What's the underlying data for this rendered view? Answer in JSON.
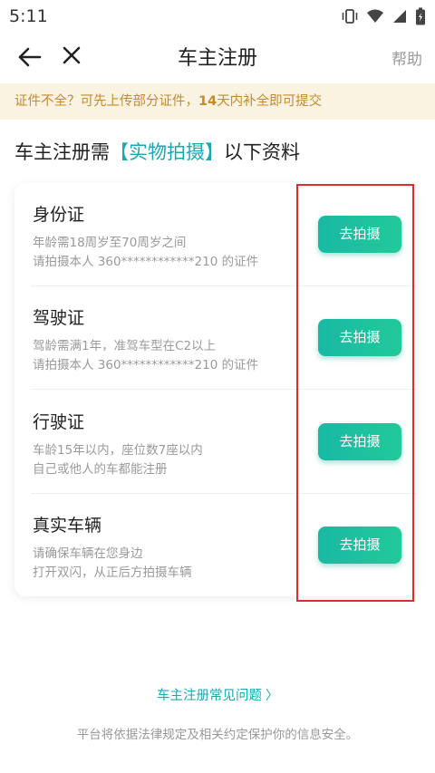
{
  "status_bar": {
    "time": "5:11"
  },
  "nav": {
    "title": "车主注册",
    "help_label": "帮助"
  },
  "notice": {
    "prefix": "证件不全？可先上传部分证件，",
    "emphasis": "14",
    "suffix": "天内补全即可提交"
  },
  "heading": {
    "before": "车主注册需",
    "accent": "【实物拍摄】",
    "after": "以下资料"
  },
  "documents": [
    {
      "title": "身份证",
      "line1": "年龄需18周岁至70周岁之间",
      "line2": "请拍摄本人 360************210 的证件",
      "button": "去拍摄"
    },
    {
      "title": "驾驶证",
      "line1": "驾龄需满1年，准驾车型在C2以上",
      "line2": "请拍摄本人 360************210 的证件",
      "button": "去拍摄"
    },
    {
      "title": "行驶证",
      "line1": "车龄15年以内，座位数7座以内",
      "line2": "自己或他人的车都能注册",
      "button": "去拍摄"
    },
    {
      "title": "真实车辆",
      "line1": "请确保车辆在您身边",
      "line2": "打开双闪，从正后方拍摄车辆",
      "button": "去拍摄"
    }
  ],
  "faq_link": "车主注册常见问题",
  "footer_note": "平台将依据法律规定及相关约定保护你的信息安全。",
  "colors": {
    "accent": "#19a9b2",
    "button_green": "#1fbf9f",
    "notice_bg": "#fbf3e2",
    "notice_text": "#c48a2e",
    "highlight": "#e22c2c"
  }
}
